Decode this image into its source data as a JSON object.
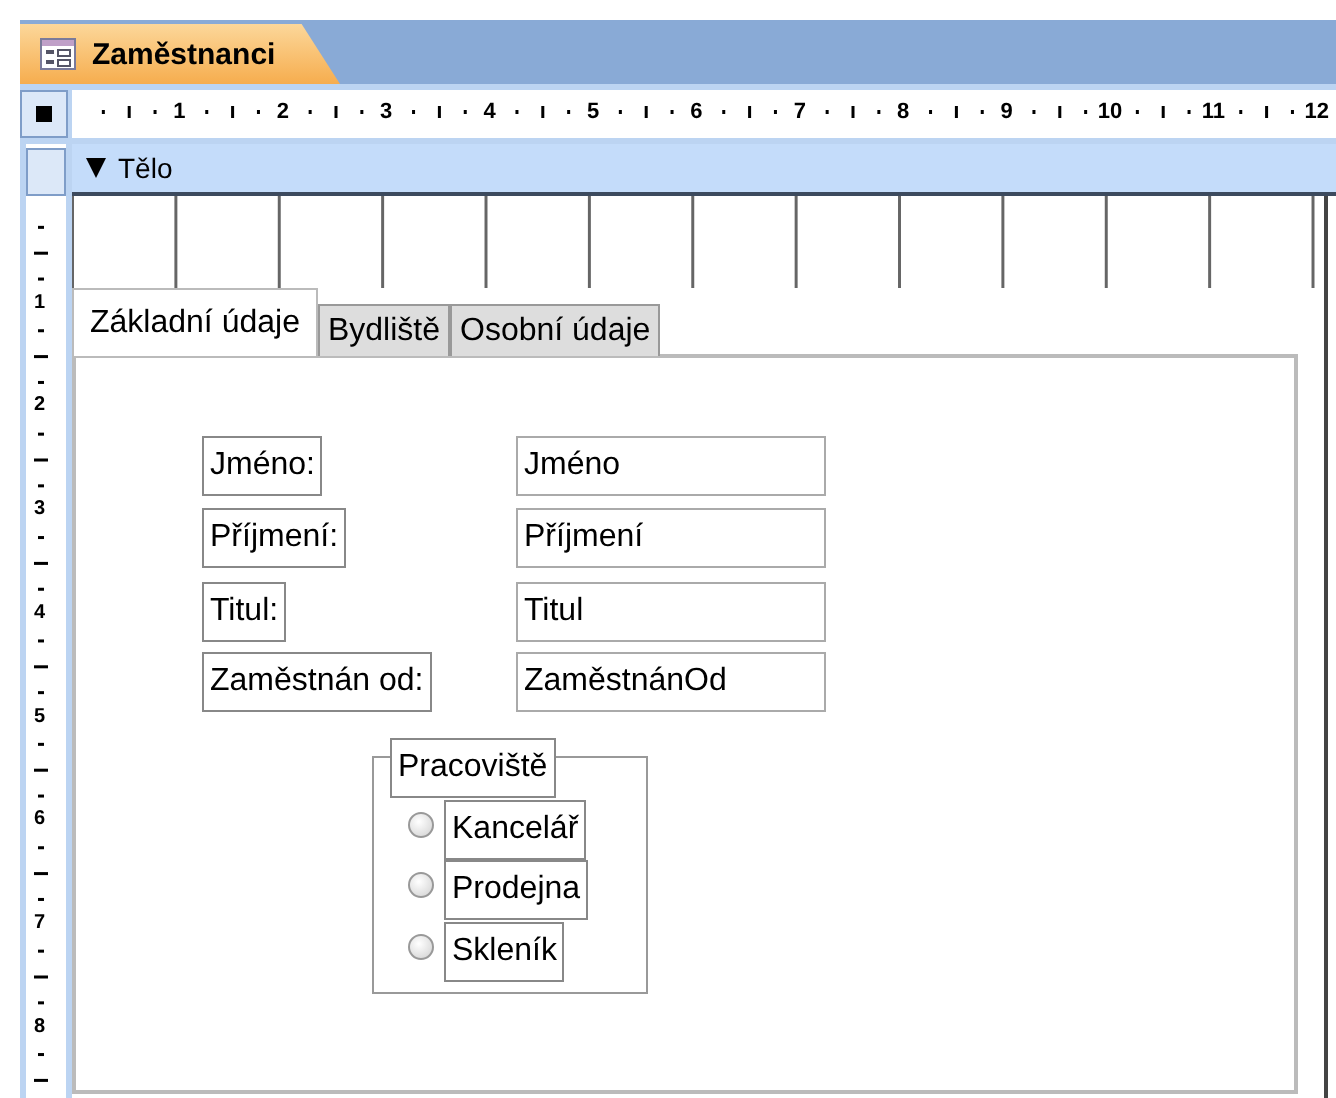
{
  "document_tab": {
    "title": "Zaměstnanci",
    "selected": true
  },
  "ruler": {
    "horizontal_labels": [
      "1",
      "2",
      "3",
      "4",
      "5",
      "6",
      "7",
      "8",
      "9",
      "10",
      "11",
      "12"
    ],
    "vertical_labels": [
      "1",
      "2",
      "3",
      "4",
      "5",
      "6",
      "7",
      "8"
    ]
  },
  "section": {
    "title": "Tělo",
    "expanded": true
  },
  "tabs": [
    {
      "label": "Základní údaje",
      "selected": true
    },
    {
      "label": "Bydliště",
      "selected": false
    },
    {
      "label": "Osobní údaje",
      "selected": false
    }
  ],
  "fields": [
    {
      "label": "Jméno:",
      "control": "Jméno"
    },
    {
      "label": "Příjmení:",
      "control": "Příjmení"
    },
    {
      "label": "Titul:",
      "control": "Titul"
    },
    {
      "label": "Zaměstnán od:",
      "control": "ZaměstnánOd"
    }
  ],
  "option_group": {
    "label": "Pracoviště",
    "options": [
      {
        "label": "Kancelář",
        "selected": false
      },
      {
        "label": "Prodejna",
        "selected": false
      },
      {
        "label": "Skleník",
        "selected": false
      }
    ]
  }
}
